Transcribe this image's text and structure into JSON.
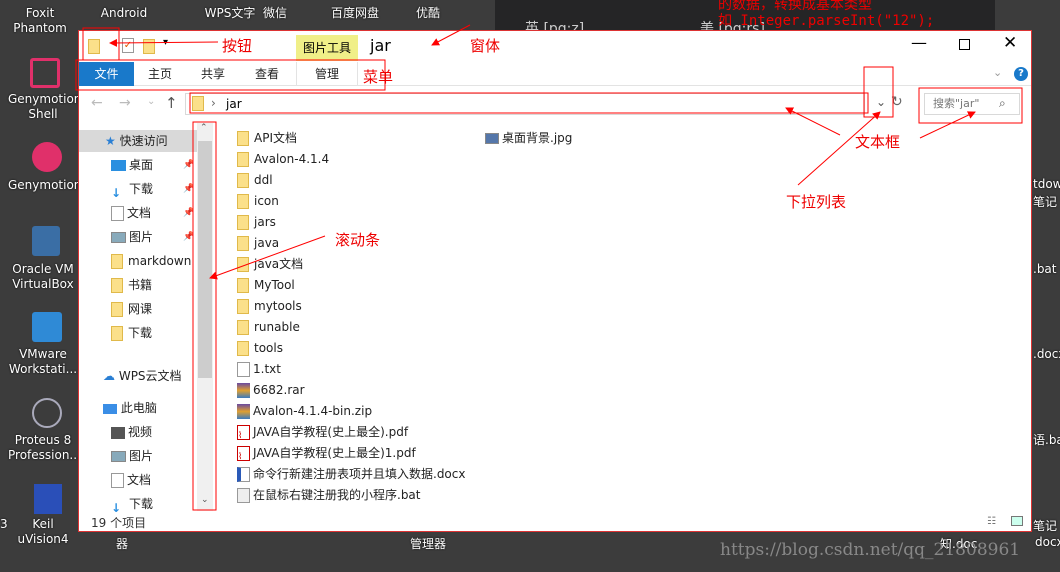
{
  "desktop": {
    "top_icons": [
      "Foxit Phantom",
      "Android",
      "WPS文字",
      "微信",
      "百度网盘",
      "优酷"
    ],
    "left_icons": [
      "Genymotion Shell",
      "Genymotion",
      "Oracle VM VirtualBox",
      "VMware Workstati...",
      "Proteus 8 Profession...",
      "Keil uVision4"
    ],
    "right_labels": [
      "tdow",
      "笔记",
      ".bat",
      ".docx",
      "语.bat",
      "笔记",
      "docx"
    ],
    "bottom_labels": [
      "器",
      "管理器",
      "知.doc",
      "docx",
      "3"
    ],
    "bg_note_lines": [
      "的数据，转换成基本类型",
      "如 Integer.parseInt(\"12\");"
    ],
    "bg_phonetics": [
      "英 [pq:z]",
      "美 [pq:rs]"
    ],
    "watermark": "https://blog.csdn.net/qq_21808961"
  },
  "window": {
    "title": "jar",
    "context_tab": "图片工具",
    "ribbon_tabs": [
      "文件",
      "主页",
      "共享",
      "查看",
      "管理"
    ],
    "address": "jar",
    "search_placeholder": "搜索\"jar\"",
    "status": "19 个项目",
    "nav": {
      "quick_access": "快速访问",
      "items": [
        {
          "label": "桌面",
          "icon": "desktop-icon",
          "pinned": true
        },
        {
          "label": "下载",
          "icon": "download-icon",
          "pinned": true
        },
        {
          "label": "文档",
          "icon": "document-icon",
          "pinned": true
        },
        {
          "label": "图片",
          "icon": "picture-icon",
          "pinned": true
        },
        {
          "label": "markdown",
          "icon": "folder-icon"
        },
        {
          "label": "书籍",
          "icon": "folder-icon"
        },
        {
          "label": "网课",
          "icon": "folder-icon"
        },
        {
          "label": "下载",
          "icon": "folder-icon"
        }
      ],
      "wps": "WPS云文档",
      "this_pc": "此电脑",
      "pc_items": [
        "视频",
        "图片",
        "文档",
        "下载"
      ]
    },
    "files": [
      "API文档",
      "Avalon-4.1.4",
      "ddl",
      "icon",
      "jars",
      "java",
      "java文档",
      "MyTool",
      "mytools",
      "runable",
      "tools",
      "1.txt",
      "6682.rar",
      "Avalon-4.1.4-bin.zip",
      "JAVA自学教程(史上最全).pdf",
      "JAVA自学教程(史上最全)1.pdf",
      "命令行新建注册表项并且填入数据.docx",
      "在鼠标右键注册我的小程序.bat"
    ],
    "files_col2": [
      "桌面背景.jpg"
    ],
    "file_types": [
      "folder",
      "folder",
      "folder",
      "folder",
      "folder",
      "folder",
      "folder",
      "folder",
      "folder",
      "folder",
      "folder",
      "txt",
      "rar",
      "zip",
      "pdf",
      "pdf",
      "docx",
      "bat"
    ]
  },
  "annotations": {
    "button": "按钮",
    "window": "窗体",
    "menu": "菜单",
    "textbox": "文本框",
    "dropdown": "下拉列表",
    "scrollbar": "滚动条"
  },
  "colors": {
    "annotation": "#ff0000",
    "file_tab": "#1979ca",
    "context_tab": "#f0ef88",
    "folder": "#fbe08a"
  }
}
